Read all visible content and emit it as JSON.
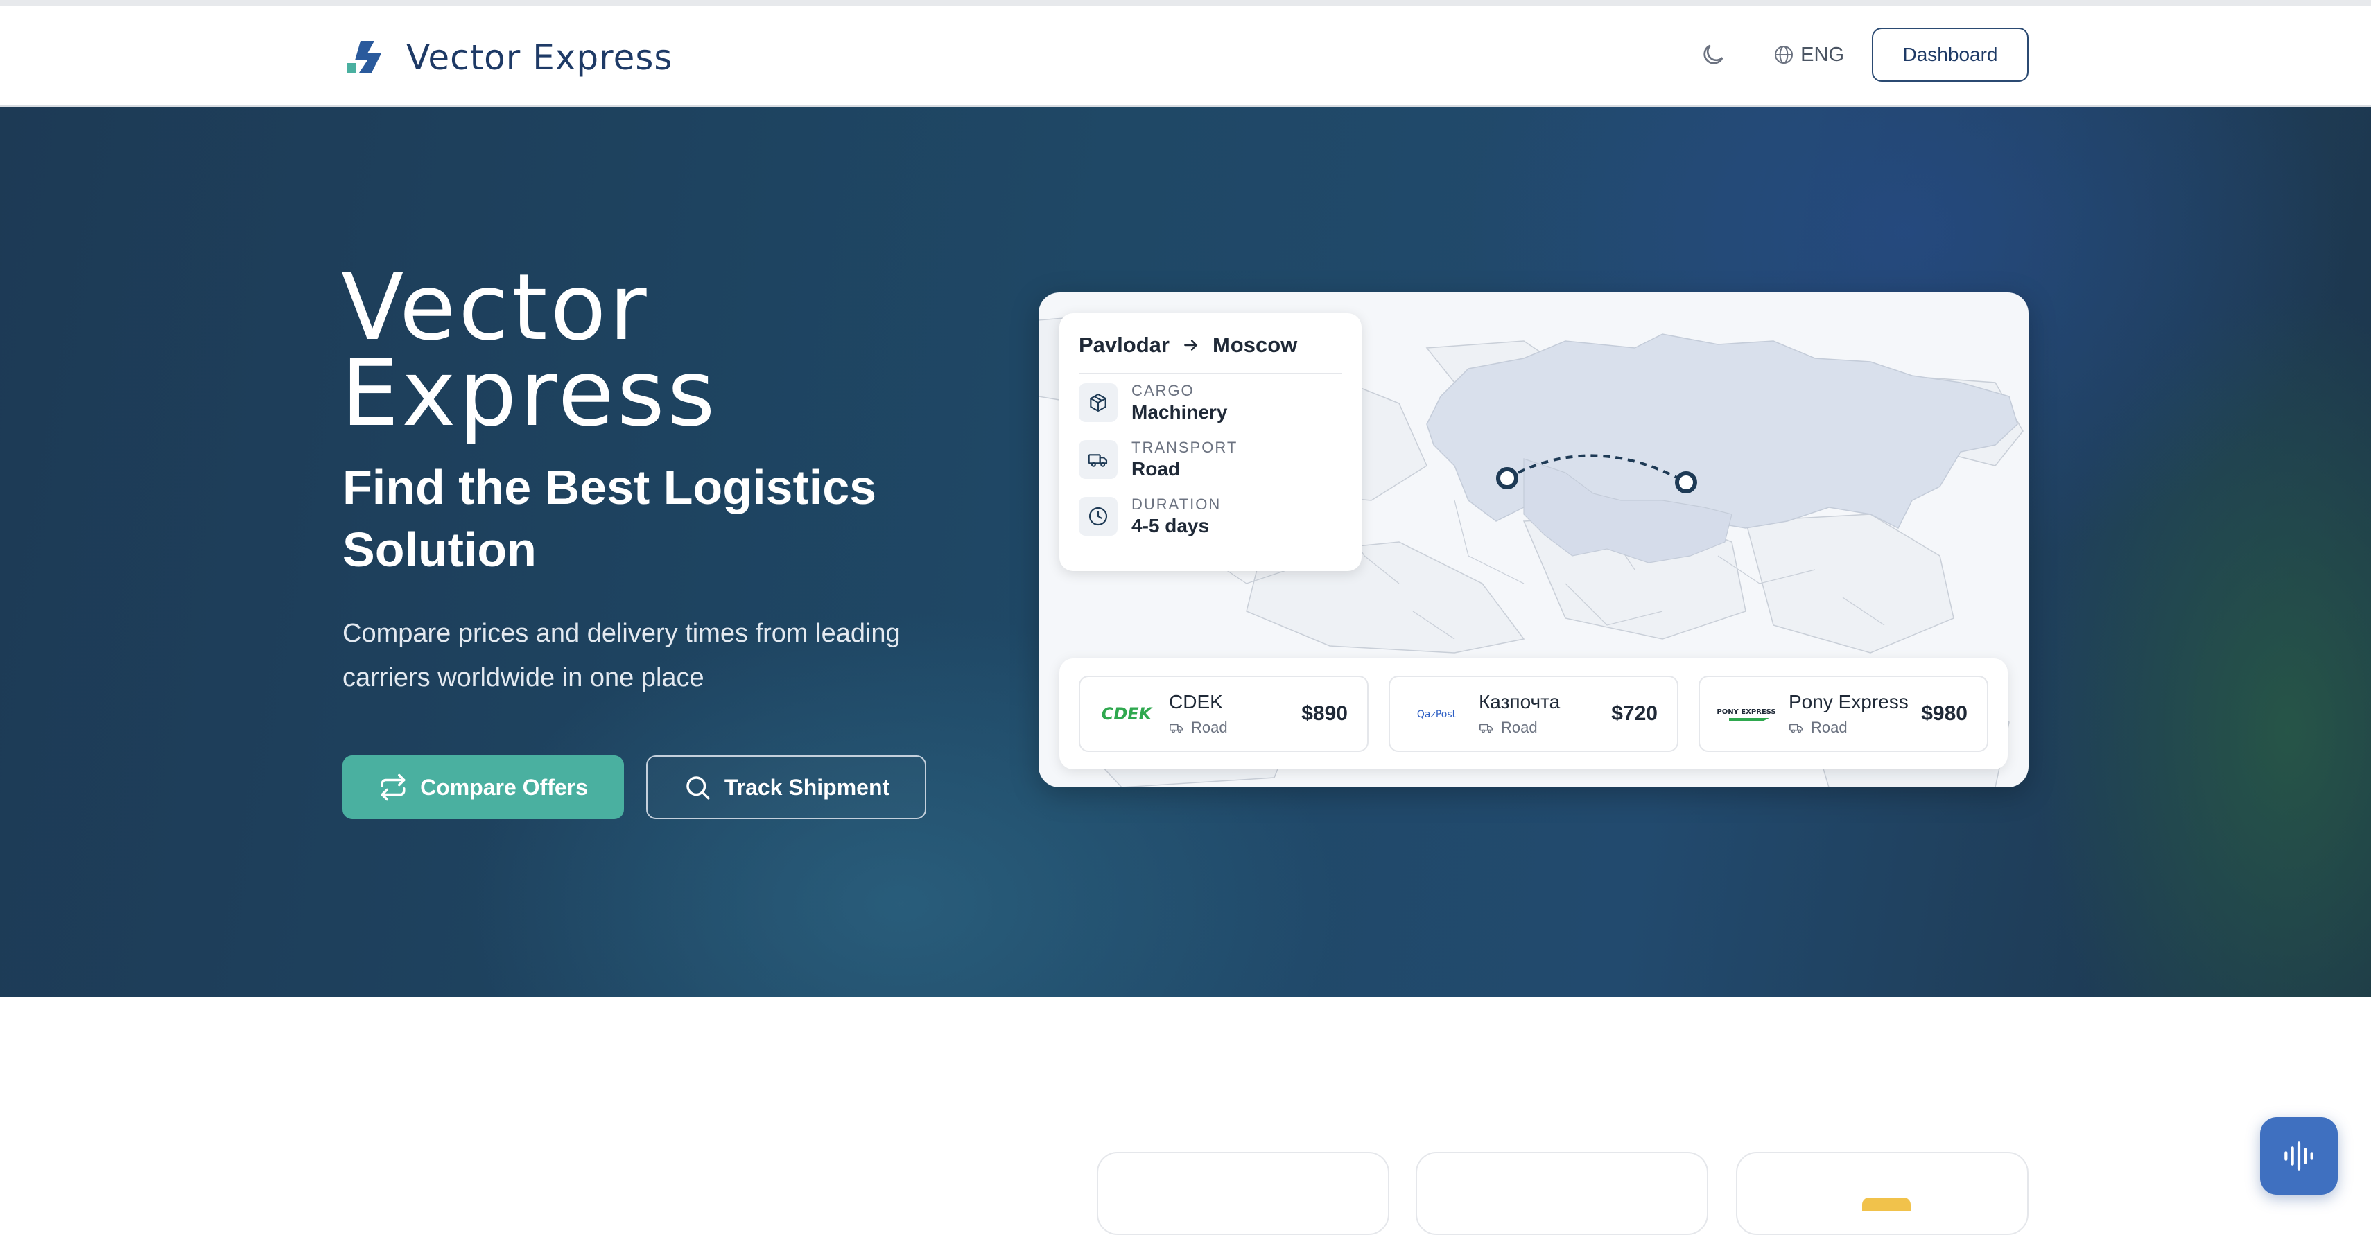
{
  "header": {
    "brand": "Vector Express",
    "language": "ENG",
    "dashboard_label": "Dashboard"
  },
  "hero": {
    "title_line1": "Vector",
    "title_line2": "Express",
    "subtitle": "Find the Best Logistics Solution",
    "description": "Compare prices and delivery times from leading carriers worldwide in one place",
    "compare_label": "Compare Offers",
    "track_label": "Track Shipment"
  },
  "route": {
    "from": "Pavlodar",
    "to": "Moscow",
    "cargo_label": "CARGO",
    "cargo_value": "Machinery",
    "transport_label": "TRANSPORT",
    "transport_value": "Road",
    "duration_label": "DURATION",
    "duration_value": "4-5 days"
  },
  "offers": [
    {
      "logo": "CDEK",
      "name": "CDEK",
      "mode": "Road",
      "price": "$890"
    },
    {
      "logo": "QazPost",
      "name": "Казпочта",
      "mode": "Road",
      "price": "$720"
    },
    {
      "logo": "PONY EXPRESS",
      "name": "Pony Express",
      "mode": "Road",
      "price": "$980"
    }
  ],
  "colors": {
    "brand_dark": "#1e3a66",
    "accent_teal": "#4ab0a0",
    "fab_blue": "#3f70c0"
  }
}
